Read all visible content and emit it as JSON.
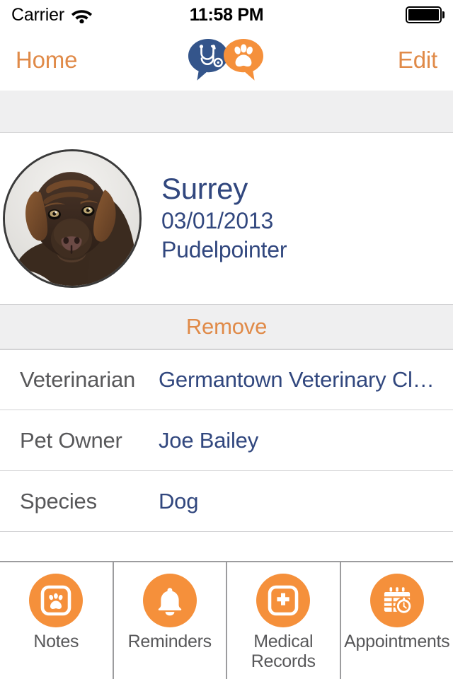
{
  "status_bar": {
    "carrier": "Carrier",
    "wifi_icon": "wifi-icon",
    "time": "11:58 PM",
    "battery_icon": "battery-full-icon",
    "battery_level": 100
  },
  "nav_bar": {
    "back_label": "Home",
    "edit_label": "Edit",
    "logo_icon": "vet-paw-speech-bubble-logo",
    "logo_colors": {
      "bubble_blue": "#34558B",
      "bubble_orange": "#F5903B"
    }
  },
  "pet": {
    "photo_icon": "pet-avatar-photo",
    "name": "Surrey",
    "date_of_birth": "03/01/2013",
    "breed": "Pudelpointer"
  },
  "actions": {
    "remove_label": "Remove"
  },
  "details": [
    {
      "label": "Veterinarian",
      "value": "Germantown Veterinary Cli…"
    },
    {
      "label": "Pet Owner",
      "value": "Joe Bailey"
    },
    {
      "label": "Species",
      "value": "Dog"
    }
  ],
  "tabs": [
    {
      "label": "Notes",
      "icon": "paw-note-icon"
    },
    {
      "label": "Reminders",
      "icon": "bell-icon"
    },
    {
      "label": "Medical\nRecords",
      "icon": "medical-cross-icon"
    },
    {
      "label": "Appointments",
      "icon": "calendar-clock-icon"
    }
  ],
  "colors": {
    "accent_orange": "#E08A48",
    "icon_orange": "#F5903B",
    "navy": "#31477E",
    "label_gray": "#58585A",
    "band_gray": "#EFEFF0",
    "separator": "#D3D3D5"
  }
}
